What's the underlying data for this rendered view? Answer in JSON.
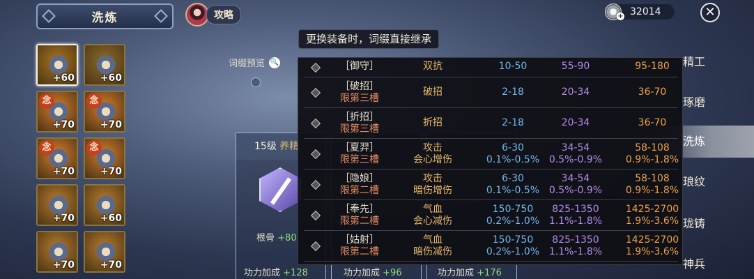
{
  "header": {
    "title": "洗炼",
    "guide_label": "攻略",
    "currency_amount": "32014",
    "plus_sign": "+"
  },
  "tooltip": "更换装备时，词缀直接继承",
  "preview_label": "词缀预览",
  "inventory": [
    {
      "level": "+60",
      "tag": "",
      "color": "#a6741f"
    },
    {
      "level": "+60",
      "tag": "",
      "color": "#8a6a2a"
    },
    {
      "level": "+70",
      "tag": "念",
      "color": "#d47a2a"
    },
    {
      "level": "+70",
      "tag": "念",
      "color": "#d47a2a"
    },
    {
      "level": "+70",
      "tag": "念",
      "color": "#d47a2a"
    },
    {
      "level": "+70",
      "tag": "念",
      "color": "#d47a2a"
    },
    {
      "level": "+70",
      "tag": "",
      "color": "#b57a2c"
    },
    {
      "level": "+60",
      "tag": "",
      "color": "#b57a2c"
    },
    {
      "level": "+70",
      "tag": "",
      "color": "#b57a2c"
    },
    {
      "level": "+70",
      "tag": "",
      "color": "#b57a2c"
    }
  ],
  "cards": [
    {
      "level_text": "15级",
      "name_text": "养精",
      "stat_label": "根骨",
      "stat_value": "+80",
      "power_label": "功力加成",
      "power_value": "+128"
    },
    {
      "power_label": "功力加成",
      "power_value": "+96"
    },
    {
      "power_label": "功力加成",
      "power_value": "+176"
    }
  ],
  "side_menu": [
    {
      "label": "精工",
      "active": false
    },
    {
      "label": "琢磨",
      "active": false
    },
    {
      "label": "洗炼",
      "active": true
    },
    {
      "label": "琅纹",
      "active": false
    },
    {
      "label": "珑铸",
      "active": false
    },
    {
      "label": "神兵",
      "active": false
    }
  ],
  "affix_table": [
    {
      "name": "［御守］",
      "slot": "",
      "type1": "双抗",
      "type2": "",
      "low": "10-50",
      "low2": "",
      "mid": "55-90",
      "mid2": "",
      "high": "95-180",
      "high2": ""
    },
    {
      "name": "［破招］",
      "slot": "限第三槽",
      "type1": "破招",
      "type2": "",
      "low": "2-18",
      "low2": "",
      "mid": "20-34",
      "mid2": "",
      "high": "36-70",
      "high2": ""
    },
    {
      "name": "［折招］",
      "slot": "限第三槽",
      "type1": "折招",
      "type2": "",
      "low": "2-18",
      "low2": "",
      "mid": "20-34",
      "mid2": "",
      "high": "36-70",
      "high2": ""
    },
    {
      "name": "［夏羿］",
      "slot": "限第三槽",
      "type1": "攻击",
      "type2": "会心增伤",
      "low": "6-30",
      "low2": "0.1%-0.5%",
      "mid": "34-54",
      "mid2": "0.5%-0.9%",
      "high": "58-108",
      "high2": "0.9%-1.8%"
    },
    {
      "name": "［隐娘］",
      "slot": "限第二槽",
      "type1": "攻击",
      "type2": "暗伤增伤",
      "low": "6-30",
      "low2": "0.1%-0.5%",
      "mid": "34-54",
      "mid2": "0.5%-0.9%",
      "high": "58-108",
      "high2": "0.9%-1.8%"
    },
    {
      "name": "［奉先］",
      "slot": "限第二槽",
      "type1": "气血",
      "type2": "会心减伤",
      "low": "150-750",
      "low2": "0.2%-1.0%",
      "mid": "825-1350",
      "mid2": "1.1%-1.8%",
      "high": "1425-2700",
      "high2": "1.9%-3.6%"
    },
    {
      "name": "［姑射］",
      "slot": "限第二槽",
      "type1": "气血",
      "type2": "暗伤减伤",
      "low": "150-750",
      "low2": "0.2%-1.0%",
      "mid": "825-1350",
      "mid2": "1.1%-1.8%",
      "high": "1425-2700",
      "high2": "1.9%-3.6%"
    }
  ],
  "colors": {
    "accent_gold": "#e6b86b",
    "tier_low": "#73b6ec",
    "tier_mid": "#b48ae8",
    "tier_high": "#f0a24a",
    "slot_limit": "#e38a62",
    "bonus_green": "#8fdb7a"
  }
}
